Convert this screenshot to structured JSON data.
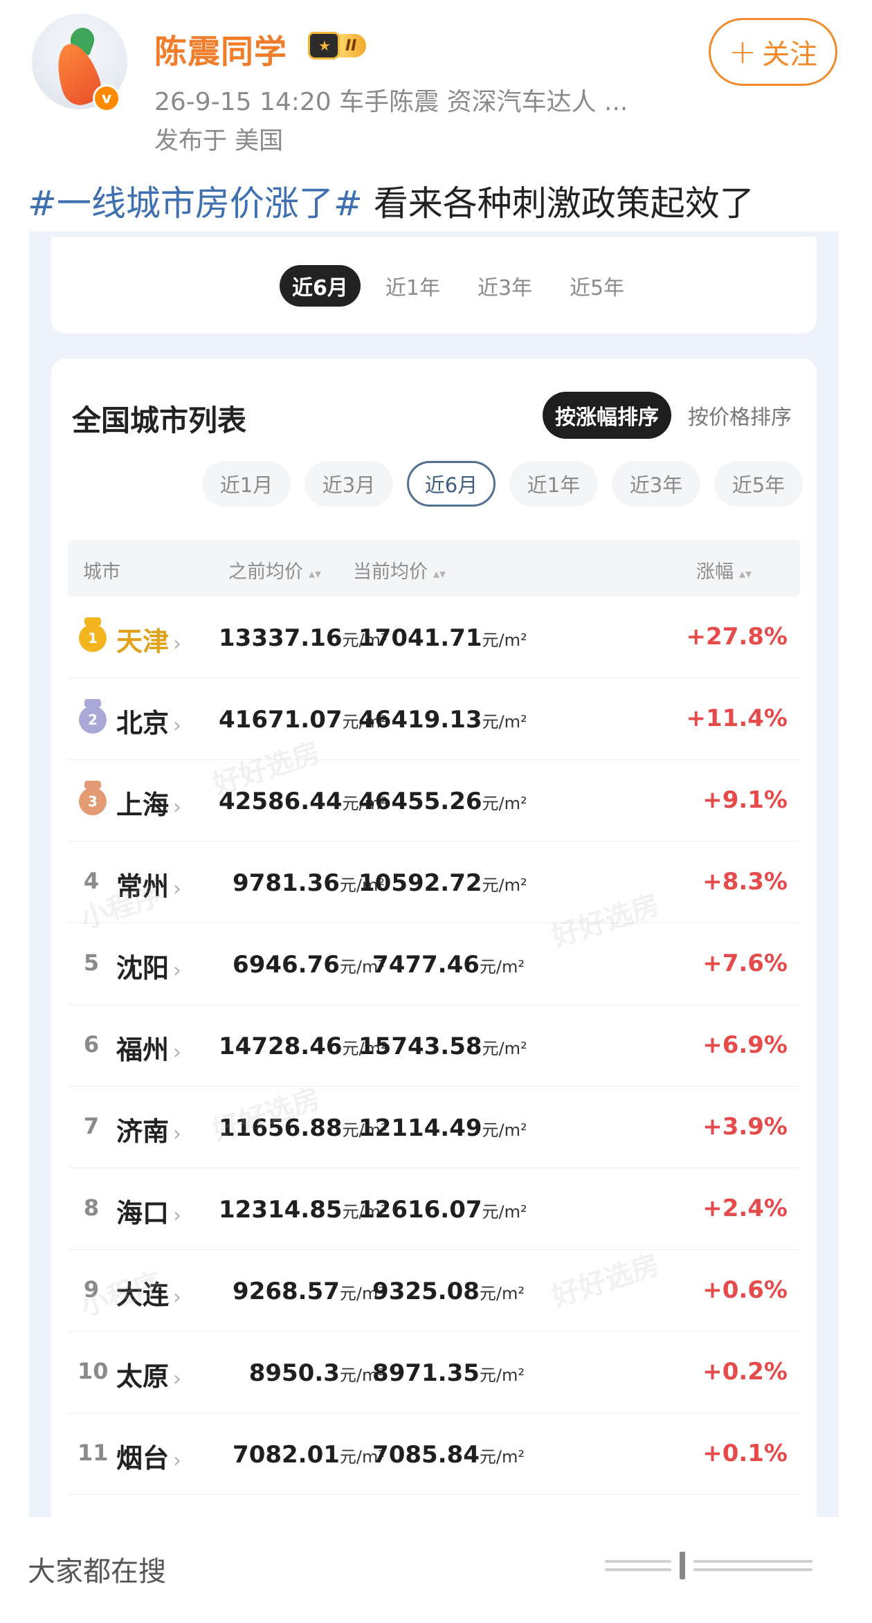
{
  "post": {
    "username": "陈震同学",
    "vip_level": "II",
    "meta": "26-9-15 14:20   车手陈震 资深汽车达人 ...",
    "published": "发布于 美国",
    "follow_label": "关注",
    "follow_icon": "plus-icon",
    "hashtag": "#一线城市房价涨了#",
    "text": " 看来各种刺激政策起效了"
  },
  "screenshot": {
    "top_tabs": [
      "近6月",
      "近1年",
      "近3年",
      "近5年"
    ],
    "top_tabs_active": "近6月",
    "list_title": "全国城市列表",
    "sort_by_change": "按涨幅排序",
    "sort_by_price": "按价格排序",
    "periods": [
      "近1月",
      "近3月",
      "近6月",
      "近1年",
      "近3年",
      "近5年"
    ],
    "period_active": "近6月",
    "columns": {
      "city": "城市",
      "prev": "之前均价",
      "curr": "当前均价",
      "change": "涨幅"
    },
    "unit": "元/m²",
    "chevron": "›",
    "sort_arrow": "▴▾",
    "watermarks": [
      "好好选房",
      "小程序"
    ],
    "rows": [
      {
        "rank": "1",
        "city": "天津",
        "prev": "13337.16",
        "curr": "17041.71",
        "change": "+27.8%"
      },
      {
        "rank": "2",
        "city": "北京",
        "prev": "41671.07",
        "curr": "46419.13",
        "change": "+11.4%"
      },
      {
        "rank": "3",
        "city": "上海",
        "prev": "42586.44",
        "curr": "46455.26",
        "change": "+9.1%"
      },
      {
        "rank": "4",
        "city": "常州",
        "prev": "9781.36",
        "curr": "10592.72",
        "change": "+8.3%"
      },
      {
        "rank": "5",
        "city": "沈阳",
        "prev": "6946.76",
        "curr": "7477.46",
        "change": "+7.6%"
      },
      {
        "rank": "6",
        "city": "福州",
        "prev": "14728.46",
        "curr": "15743.58",
        "change": "+6.9%"
      },
      {
        "rank": "7",
        "city": "济南",
        "prev": "11656.88",
        "curr": "12114.49",
        "change": "+3.9%"
      },
      {
        "rank": "8",
        "city": "海口",
        "prev": "12314.85",
        "curr": "12616.07",
        "change": "+2.4%"
      },
      {
        "rank": "9",
        "city": "大连",
        "prev": "9268.57",
        "curr": "9325.08",
        "change": "+0.6%"
      },
      {
        "rank": "10",
        "city": "太原",
        "prev": "8950.3",
        "curr": "8971.35",
        "change": "+0.2%"
      },
      {
        "rank": "11",
        "city": "烟台",
        "prev": "7082.01",
        "curr": "7085.84",
        "change": "+0.1%"
      }
    ],
    "medal_colors": [
      "#f2b51f",
      "#a9a8d6",
      "#e39b73"
    ]
  },
  "footer": {
    "trending": "大家都在搜"
  },
  "colors": {
    "username": "#ef7d2a",
    "hashtag": "#3e6fb0",
    "increase": "#e64b4b",
    "follow": "#f08a2b"
  }
}
